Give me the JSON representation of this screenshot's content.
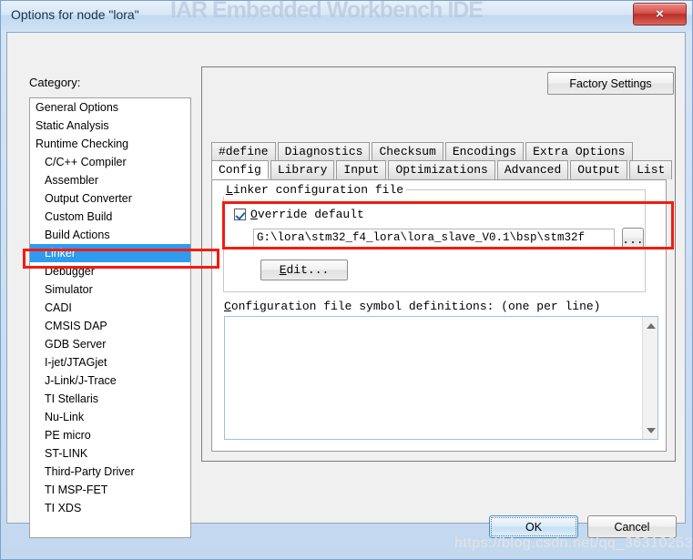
{
  "window": {
    "title": "Options for node \"lora\"",
    "ghost_text": "IAR Embedded Workbench IDE",
    "close_icon": "×"
  },
  "category": {
    "label": "Category:",
    "selected": "Linker",
    "items": [
      {
        "label": "General Options",
        "indent": false
      },
      {
        "label": "Static Analysis",
        "indent": false
      },
      {
        "label": "Runtime Checking",
        "indent": false
      },
      {
        "label": "C/C++ Compiler",
        "indent": true
      },
      {
        "label": "Assembler",
        "indent": true
      },
      {
        "label": "Output Converter",
        "indent": true
      },
      {
        "label": "Custom Build",
        "indent": true
      },
      {
        "label": "Build Actions",
        "indent": true
      },
      {
        "label": "Linker",
        "indent": true
      },
      {
        "label": "Debugger",
        "indent": true
      },
      {
        "label": "Simulator",
        "indent": true
      },
      {
        "label": "CADI",
        "indent": true
      },
      {
        "label": "CMSIS DAP",
        "indent": true
      },
      {
        "label": "GDB Server",
        "indent": true
      },
      {
        "label": "I-jet/JTAGjet",
        "indent": true
      },
      {
        "label": "J-Link/J-Trace",
        "indent": true
      },
      {
        "label": "TI Stellaris",
        "indent": true
      },
      {
        "label": "Nu-Link",
        "indent": true
      },
      {
        "label": "PE micro",
        "indent": true
      },
      {
        "label": "ST-LINK",
        "indent": true
      },
      {
        "label": "Third-Party Driver",
        "indent": true
      },
      {
        "label": "TI MSP-FET",
        "indent": true
      },
      {
        "label": "TI XDS",
        "indent": true
      }
    ]
  },
  "factory_settings": {
    "label": "Factory Settings"
  },
  "tabs": {
    "row1": [
      {
        "label": "#define",
        "active": false
      },
      {
        "label": "Diagnostics",
        "active": false
      },
      {
        "label": "Checksum",
        "active": false
      },
      {
        "label": "Encodings",
        "active": false
      },
      {
        "label": "Extra Options",
        "active": false
      }
    ],
    "row2": [
      {
        "label": "Config",
        "active": true
      },
      {
        "label": "Library",
        "active": false
      },
      {
        "label": "Input",
        "active": false
      },
      {
        "label": "Optimizations",
        "active": false
      },
      {
        "label": "Advanced",
        "active": false
      },
      {
        "label": "Output",
        "active": false
      },
      {
        "label": "List",
        "active": false
      }
    ]
  },
  "config_tab": {
    "group_title_prefix": "L",
    "group_title_rest": "inker configuration file",
    "override": {
      "checked": true,
      "mnemonic": "O",
      "label_rest": "verride default"
    },
    "path_value": "G:\\lora\\stm32_f4_lora\\lora_slave_V0.1\\bsp\\stm32f",
    "browse_label": "...",
    "edit_mnemonic": "E",
    "edit_label_rest": "dit...",
    "symbols": {
      "label_mnemonic": "C",
      "label_rest": "onfiguration file symbol definitions: (one per line)",
      "value": "",
      "scroll_up_icon": "triangle-up",
      "scroll_down_icon": "triangle-down"
    }
  },
  "footer": {
    "ok_label": "OK",
    "cancel_label": "Cancel"
  },
  "watermark": {
    "text": "https://blog.csdn.net/qq_36310253"
  },
  "colors": {
    "selection_blue": "#2e9bf0",
    "annotation_red": "#f41b10",
    "close_red": "#bb2f27",
    "title_blue": "#c2d9f0"
  }
}
